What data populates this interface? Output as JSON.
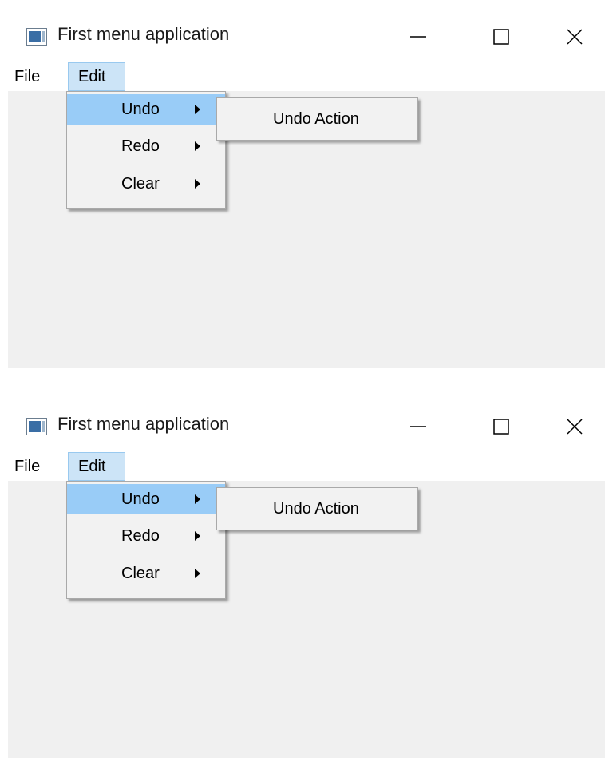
{
  "screens": [
    {
      "window": {
        "title": "First menu application",
        "icon": "app-window-icon"
      },
      "caption_buttons": {
        "minimize_icon": "minimize-icon",
        "maximize_icon": "maximize-icon",
        "close_icon": "close-icon"
      },
      "menubar": {
        "items": [
          {
            "label": "File"
          },
          {
            "label": "Edit"
          }
        ]
      },
      "edit_menu": {
        "items": [
          {
            "label": "Undo",
            "highlighted": true
          },
          {
            "label": "Redo",
            "highlighted": false
          },
          {
            "label": "Clear",
            "highlighted": false
          }
        ]
      },
      "undo_submenu": {
        "items": [
          {
            "label": "Undo Action"
          }
        ]
      }
    },
    {
      "window": {
        "title": "First menu application",
        "icon": "app-window-icon"
      },
      "caption_buttons": {
        "minimize_icon": "minimize-icon",
        "maximize_icon": "maximize-icon",
        "close_icon": "close-icon"
      },
      "menubar": {
        "items": [
          {
            "label": "File"
          },
          {
            "label": "Edit"
          }
        ]
      },
      "edit_menu": {
        "items": [
          {
            "label": "Undo",
            "highlighted": true
          },
          {
            "label": "Redo",
            "highlighted": false
          },
          {
            "label": "Clear",
            "highlighted": false
          }
        ]
      },
      "undo_submenu": {
        "items": [
          {
            "label": "Undo Action"
          }
        ]
      }
    }
  ],
  "colors": {
    "menu_highlight": "#99ccf7",
    "menubar_selected": "#cce4f7",
    "client_background": "#f0f0f0"
  }
}
